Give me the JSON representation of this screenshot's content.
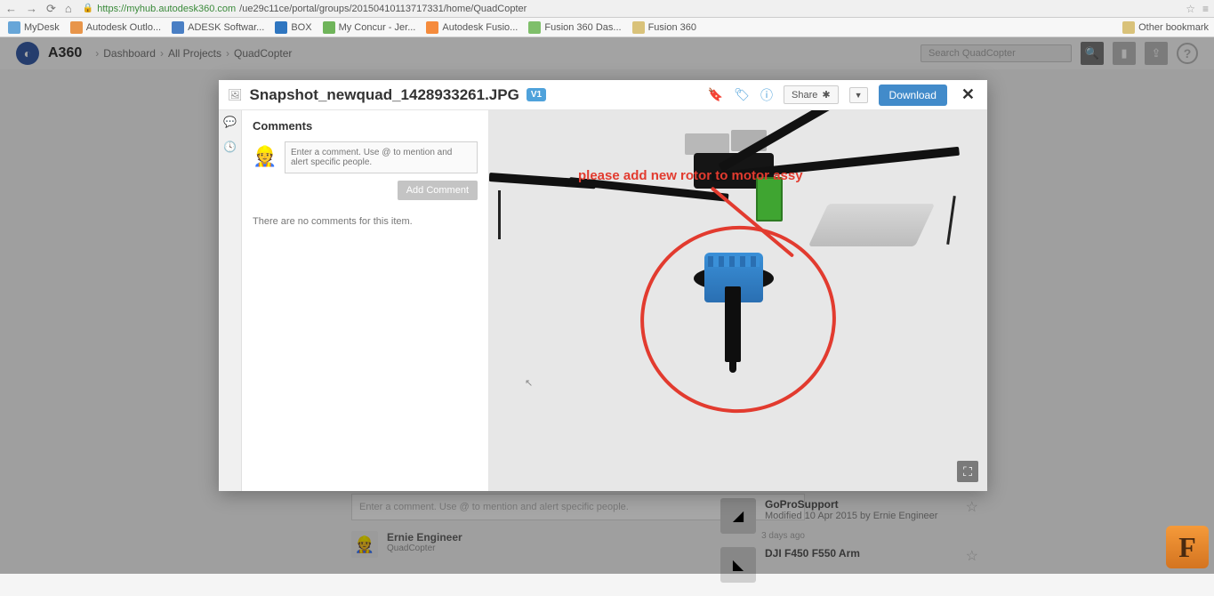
{
  "browser": {
    "url_secure_prefix": "https://",
    "url_host": "myhub.autodesk360.com",
    "url_path": "/ue29c11ce/portal/groups/20150410113717331/home/QuadCopter",
    "bookmarks": [
      {
        "label": "MyDesk"
      },
      {
        "label": "Autodesk Outlo..."
      },
      {
        "label": "ADESK Softwar..."
      },
      {
        "label": "BOX"
      },
      {
        "label": "My Concur - Jer..."
      },
      {
        "label": "Autodesk Fusio..."
      },
      {
        "label": "Fusion 360 Das..."
      },
      {
        "label": "Fusion 360"
      }
    ],
    "other_bookmarks": "Other bookmark"
  },
  "a360": {
    "brand": "A360",
    "breadcrumb": [
      "Dashboard",
      "All Projects",
      "QuadCopter"
    ],
    "search_placeholder": "Search QuadCopter"
  },
  "modal": {
    "filename": "Snapshot_newquad_1428933261.JPG",
    "version": "V1",
    "share_label": "Share",
    "download_label": "Download",
    "comments_heading": "Comments",
    "comment_placeholder": "Enter a comment. Use @ to mention and alert specific people.",
    "add_comment_label": "Add Comment",
    "empty_comments": "There are no comments for this item.",
    "annotation_text": "please add new rotor to motor assy"
  },
  "background": {
    "comment_box_placeholder": "Enter a comment. Use @ to mention and alert specific people.",
    "activity_user": "Ernie Engineer",
    "activity_project": "QuadCopter",
    "activity_age": "3 days ago",
    "item1_title": "GoProSupport",
    "item1_meta": "Modified 10 Apr 2015 by Ernie Engineer",
    "item2_title": "DJI F450 F550 Arm"
  }
}
